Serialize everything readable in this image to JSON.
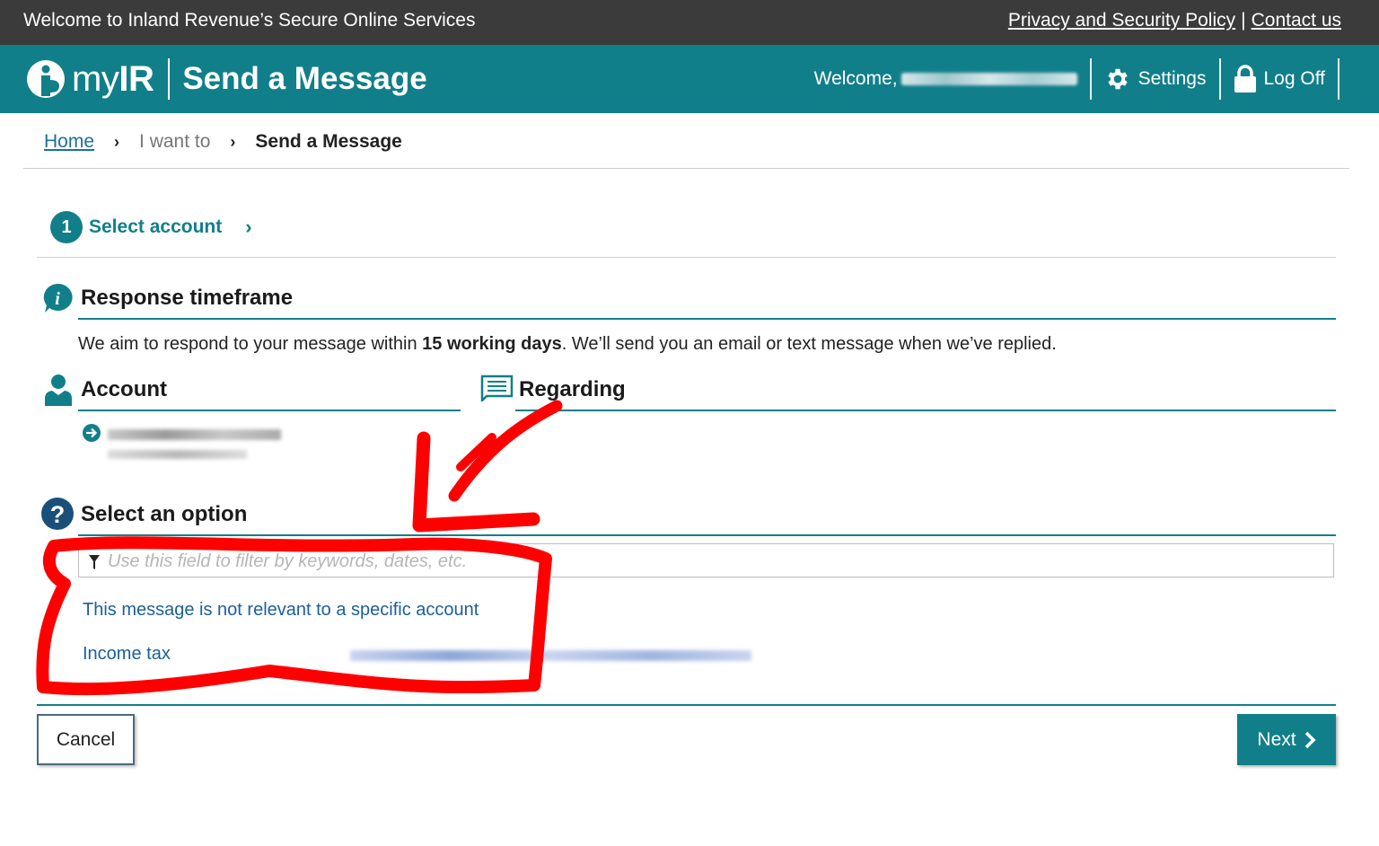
{
  "topbar": {
    "welcome_text": "Welcome to Inland Revenue’s Secure Online Services",
    "privacy_link": "Privacy and Security Policy",
    "separator": "|",
    "contact_link": "Contact us"
  },
  "header": {
    "logo_prefix": "my",
    "logo_suffix": "IR",
    "page_heading": "Send a Message",
    "welcome_label": "Welcome,",
    "settings_label": "Settings",
    "logoff_label": "Log Off",
    "accent_color": "#117f8a"
  },
  "breadcrumb": {
    "home": "Home",
    "middle": "I want to",
    "current": "Send a Message"
  },
  "step": {
    "number": "1",
    "label": "Select account"
  },
  "response": {
    "title": "Response timeframe",
    "text_before": "We aim to respond to your message within ",
    "text_bold": "15 working days",
    "text_after": ". We’ll send you an email or text message when we’ve replied."
  },
  "account": {
    "title": "Account"
  },
  "regarding": {
    "title": "Regarding"
  },
  "select_option": {
    "title": "Select an option",
    "filter_placeholder": "Use this field to filter by keywords, dates, etc.",
    "options": [
      "This message is not relevant to a specific account",
      "Income tax"
    ]
  },
  "buttons": {
    "cancel": "Cancel",
    "next": "Next"
  },
  "icons": [
    "info-icon",
    "person-icon",
    "message-icon",
    "question-icon",
    "gear-icon",
    "lock-icon",
    "arrow-circle-icon",
    "filter-icon"
  ],
  "annotation_color": "#ff0000"
}
